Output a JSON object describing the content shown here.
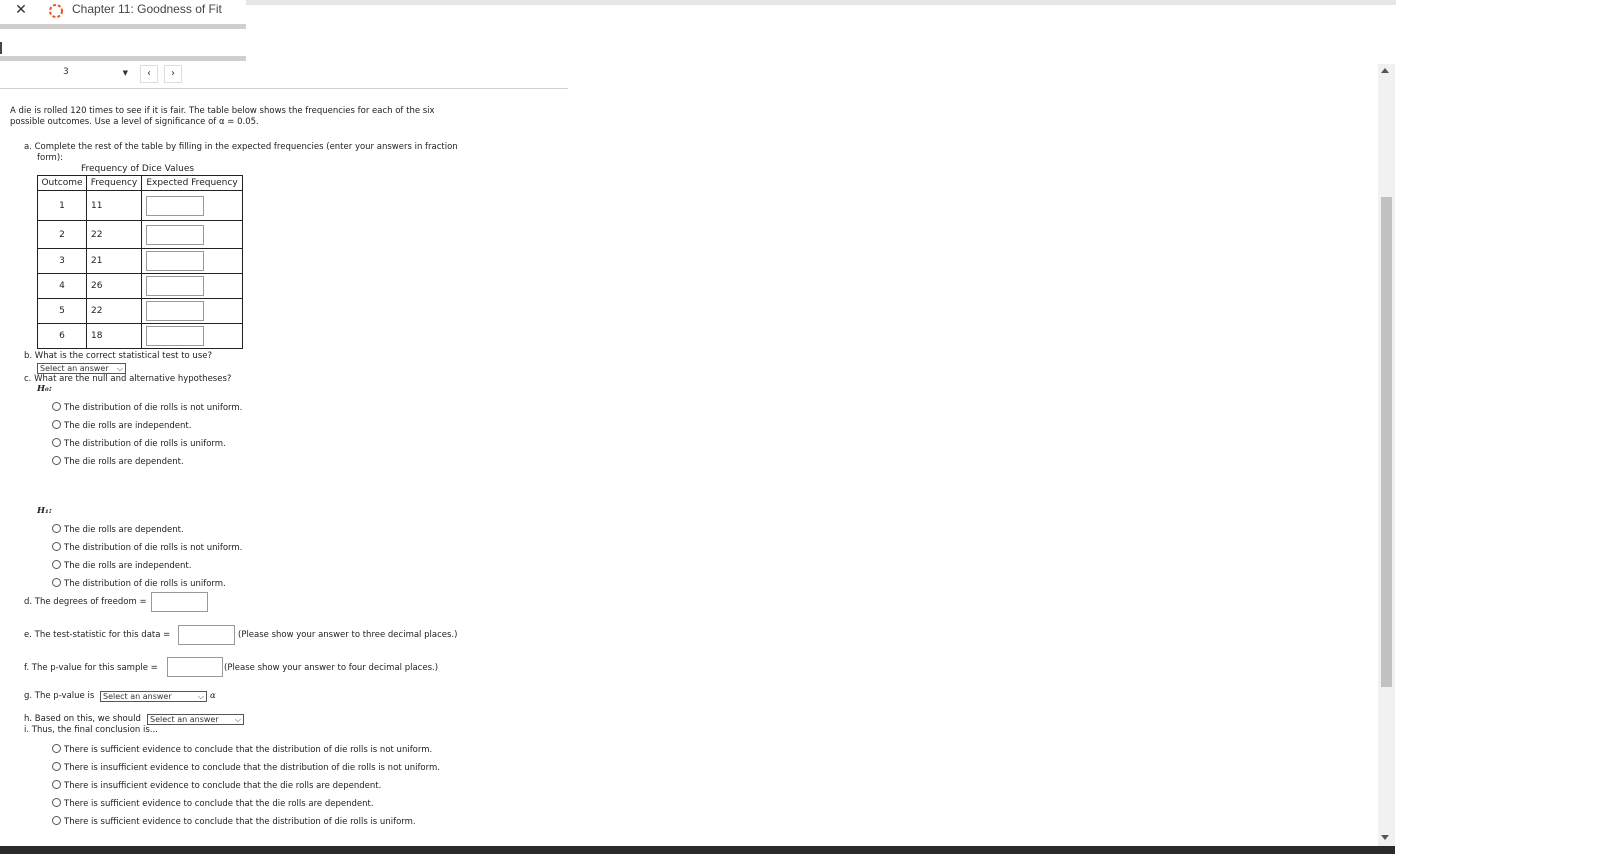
{
  "window": {
    "close_label": "✕",
    "tab_title": "Chapter 11: Goodness of Fit"
  },
  "nav": {
    "question_number": "3",
    "prev": "‹",
    "next": "›"
  },
  "question": {
    "intro_line1": "A die is rolled 120 times to see if it is fair. The table below shows the frequencies for each of the six",
    "intro_line2": "possible outcomes.  Use a level of significance of α = 0.05.",
    "part_a_line1": "a. Complete the rest of the table by filling in the expected frequencies (enter your answers in fraction",
    "part_a_line2": "form):",
    "table": {
      "caption": "Frequency of Dice Values",
      "headers": [
        "Outcome",
        "Frequency",
        "Expected Frequency"
      ],
      "rows": [
        {
          "outcome": "1",
          "frequency": "11"
        },
        {
          "outcome": "2",
          "frequency": "22"
        },
        {
          "outcome": "3",
          "frequency": "21"
        },
        {
          "outcome": "4",
          "frequency": "26"
        },
        {
          "outcome": "5",
          "frequency": "22"
        },
        {
          "outcome": "6",
          "frequency": "18"
        }
      ]
    },
    "part_b": "b. What is the correct statistical test to use?",
    "select_placeholder": "Select an answer",
    "part_c": "c. What are the null and alternative hypotheses?",
    "h0_label": "H₀:",
    "h0_options": [
      "The distribution of die rolls is not uniform.",
      "The die rolls are independent.",
      "The distribution of die rolls is uniform.",
      "The die rolls are dependent."
    ],
    "h1_label": "H₁:",
    "h1_options": [
      "The die rolls are dependent.",
      "The distribution of die rolls is not uniform.",
      "The die rolls are independent.",
      "The distribution of die rolls is uniform."
    ],
    "part_d": "d. The degrees of freedom =",
    "part_e": "e. The test-statistic for this data =",
    "part_e_note": "(Please show your answer to three decimal places.)",
    "part_f": "f. The p-value for this sample =",
    "part_f_note": "(Please show your answer to four decimal places.)",
    "part_g": "g. The p-value is",
    "part_g_suffix": "α",
    "part_h": "h. Based on this, we should",
    "part_i": "i. Thus, the final conclusion is...",
    "conclusion_options": [
      "There is sufficient evidence to conclude that the distribution of die rolls is not uniform.",
      "There is insufficient evidence to conclude that the distribution of die rolls is not uniform.",
      "There is insufficient evidence to conclude that the die rolls are dependent.",
      "There is sufficient evidence to conclude that the die rolls are dependent.",
      "There is sufficient evidence to conclude that the distribution of die rolls is uniform."
    ]
  },
  "colors": {
    "accent_orange": "#e8561c",
    "scroll_thumb": "#c1c1c1"
  }
}
